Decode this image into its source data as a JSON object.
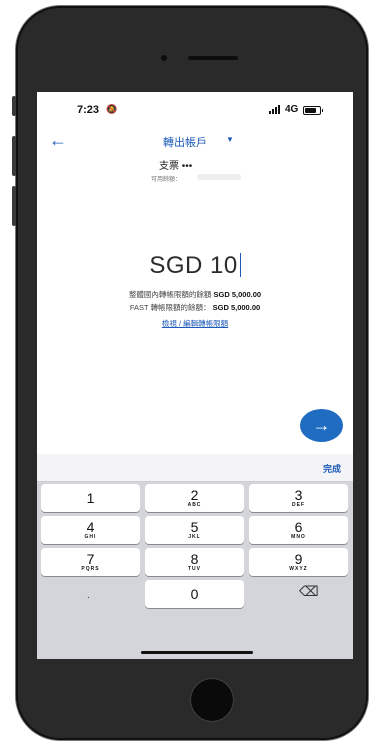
{
  "status_bar": {
    "time": "7:23",
    "bell_icon": "bell-muted-icon",
    "network": "4G"
  },
  "header": {
    "back_icon": "arrow-left-icon",
    "title": "轉出帳戶",
    "dropdown_icon": "triangle-down-icon"
  },
  "account": {
    "name": "支票 •••",
    "balance_label": "可用餘額："
  },
  "amount": {
    "value": "SGD 10"
  },
  "limits": {
    "domestic_label": "整體國內轉帳限額的餘額",
    "domestic_value": "SGD 5,000.00",
    "fast_label": "FAST 轉帳限額的餘額：",
    "fast_value": "SGD 5,000.00",
    "edit_link": "檢視 / 編輯轉帳限額"
  },
  "next_button": {
    "icon": "arrow-right-icon",
    "symbol": "→"
  },
  "keyboard": {
    "done": "完成",
    "keys": [
      {
        "digit": "1",
        "letters": ""
      },
      {
        "digit": "2",
        "letters": "ABC"
      },
      {
        "digit": "3",
        "letters": "DEF"
      },
      {
        "digit": "4",
        "letters": "GHI"
      },
      {
        "digit": "5",
        "letters": "JKL"
      },
      {
        "digit": "6",
        "letters": "MNO"
      },
      {
        "digit": "7",
        "letters": "PQRS"
      },
      {
        "digit": "8",
        "letters": "TUV"
      },
      {
        "digit": "9",
        "letters": "WXYZ"
      },
      {
        "digit": "0",
        "letters": ""
      }
    ],
    "dot": ".",
    "delete_icon": "backspace-icon",
    "delete_symbol": "⌫"
  },
  "colors": {
    "accent": "#1e5bb8",
    "button": "#1f6cc0",
    "keyboard_bg": "#d3d5da"
  }
}
